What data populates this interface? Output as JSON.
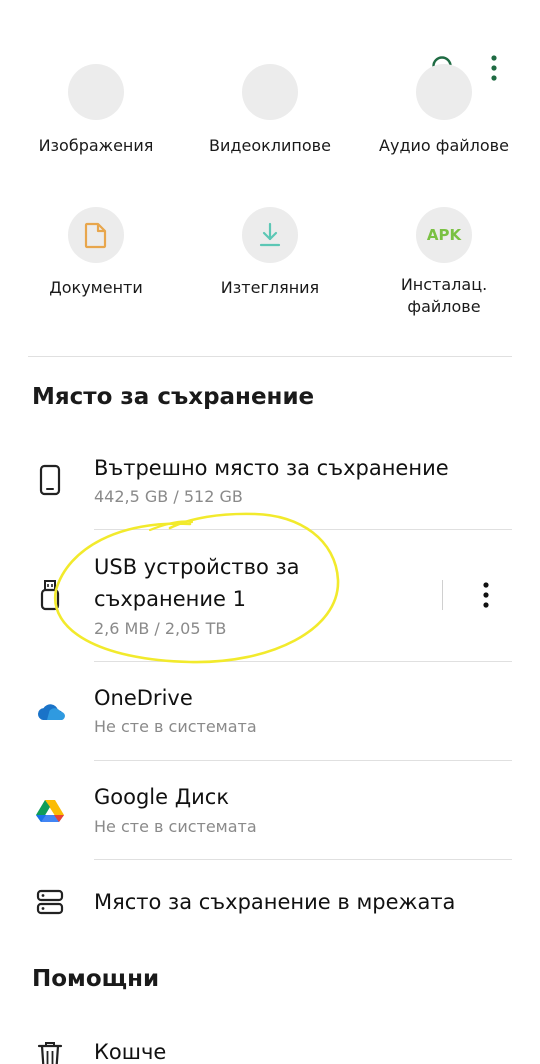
{
  "categories_top": [
    {
      "label": "Изображения"
    },
    {
      "label": "Видеоклипове"
    },
    {
      "label": "Аудио файлове"
    }
  ],
  "categories_bottom": [
    {
      "label": "Документи",
      "icon": "document-icon"
    },
    {
      "label": "Изтегляния",
      "icon": "download-icon"
    },
    {
      "label": "Инсталац.\nфайлове",
      "icon": "apk-icon",
      "badge": "APK"
    }
  ],
  "storage": {
    "title": "Място за съхранение",
    "items": [
      {
        "title": "Вътрешно място за съхранение",
        "subtitle": "442,5 GB / 512 GB"
      },
      {
        "title": "USB устройство за\nсъхранение 1",
        "subtitle": "2,6 MB / 2,05 TB"
      },
      {
        "title": "OneDrive",
        "subtitle": "Не сте в системата"
      },
      {
        "title": "Google Диск",
        "subtitle": "Не сте в системата"
      },
      {
        "title": "Място за съхранение в мрежата"
      }
    ]
  },
  "utilities": {
    "title": "Помощни",
    "items": [
      {
        "title": "Кошче"
      }
    ]
  },
  "colors": {
    "accent": "#1f6b43",
    "icon_bg": "#ececec",
    "apk": "#7ac143",
    "download": "#5cc7b5",
    "document": "#e8a64c",
    "highlight": "#f2ea2c"
  }
}
